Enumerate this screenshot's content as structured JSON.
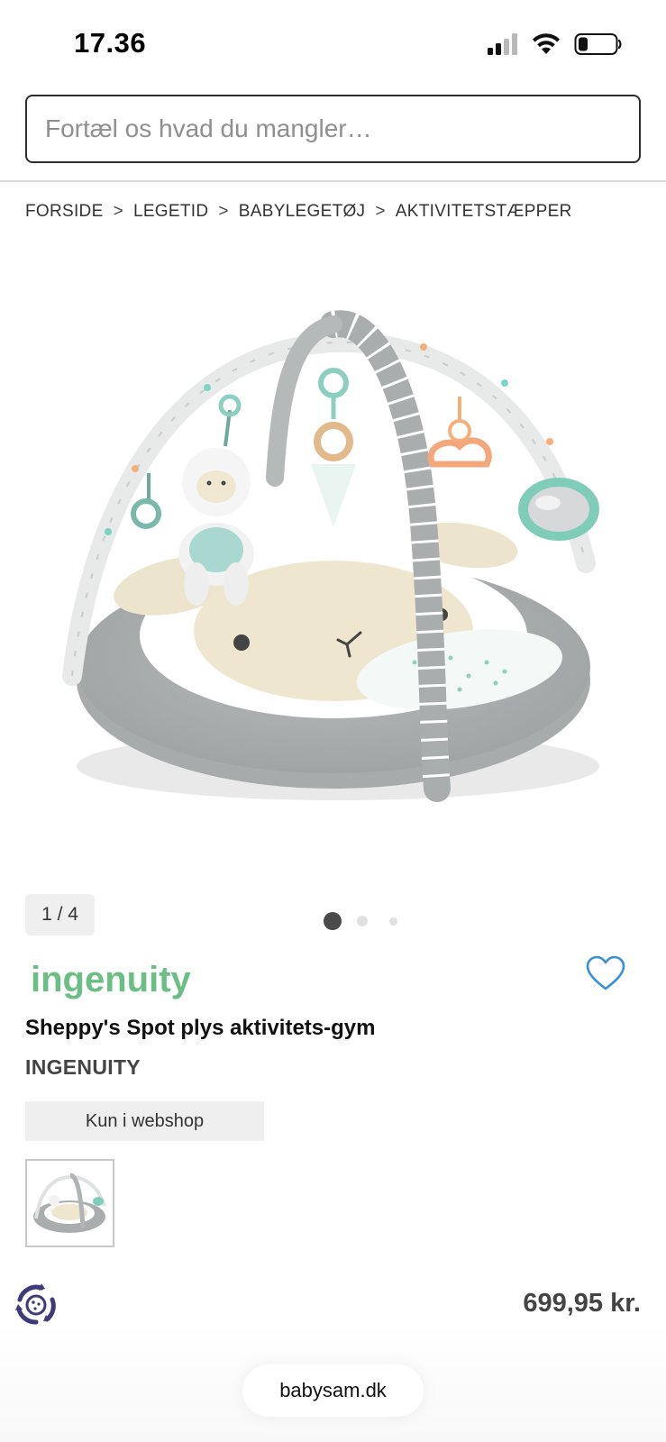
{
  "status_bar": {
    "time": "17.36",
    "icons": [
      "cellular-signal-icon",
      "wifi-icon",
      "battery-icon"
    ]
  },
  "search": {
    "placeholder": "Fortæl os hvad du mangler…",
    "value": ""
  },
  "breadcrumb": {
    "items": [
      "FORSIDE",
      "LEGETID",
      "BABYLEGETØJ",
      "AKTIVITETSTÆPPER"
    ],
    "separator": ">"
  },
  "gallery": {
    "counter": "1 / 4",
    "dots": 3,
    "active_dot": 0
  },
  "product": {
    "brand_logo_text": "ingenuity",
    "title": "Sheppy's Spot plys aktivitets-gym",
    "brand": "INGENUITY",
    "availability": "Kun i webshop",
    "price": "699,95 kr."
  },
  "browser": {
    "url": "babysam.dk"
  },
  "colors": {
    "brand_green": "#6cbf84",
    "favorite_blue": "#3a8fd8",
    "text_dark": "#111111",
    "badge_bg": "#efefef",
    "help_purple": "#3f3a7a"
  }
}
